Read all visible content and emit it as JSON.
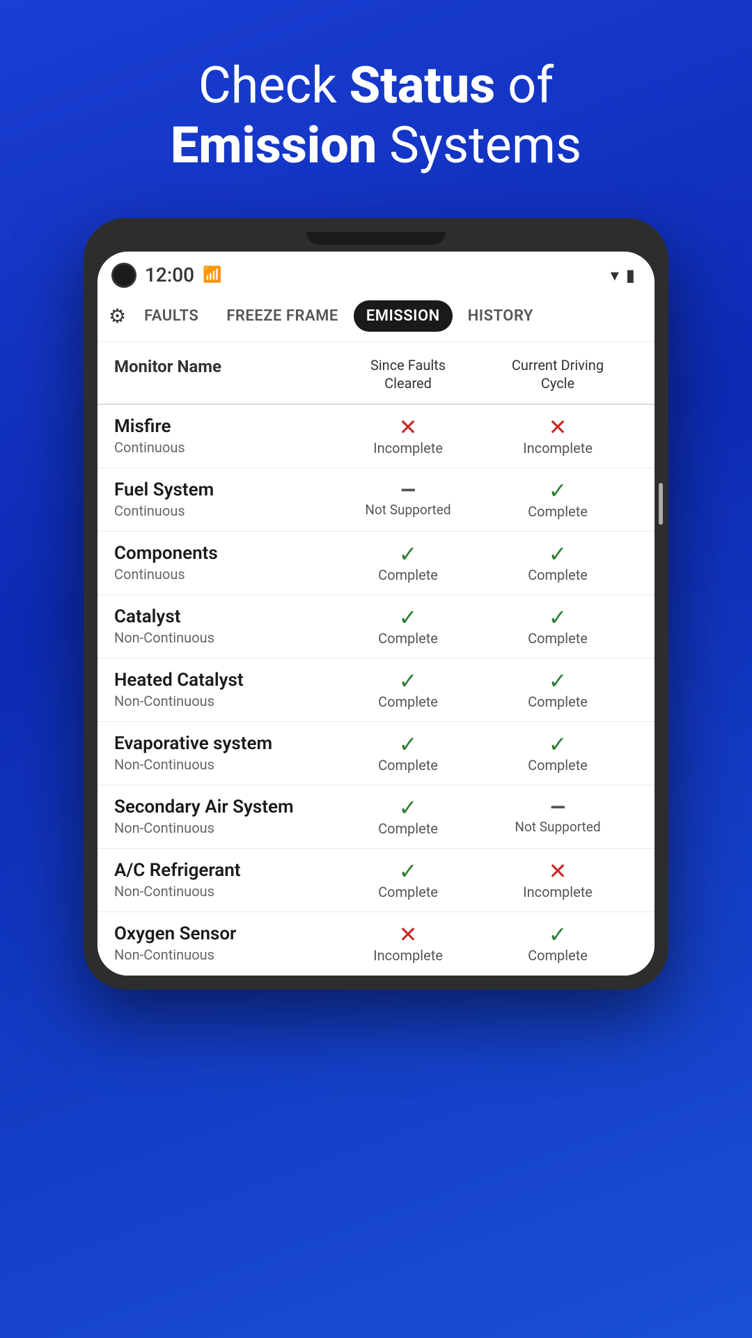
{
  "hero": {
    "line1": "Check ",
    "line1_bold": "Status",
    "line1_end": " of",
    "line2_bold": "Emission",
    "line2_end": " Systems"
  },
  "status_bar": {
    "time": "12:00"
  },
  "nav": {
    "tabs": [
      {
        "id": "faults",
        "label": "Faults",
        "active": false
      },
      {
        "id": "freeze_frame",
        "label": "Freeze Frame",
        "active": false
      },
      {
        "id": "emission",
        "label": "Emission",
        "active": true
      },
      {
        "id": "history",
        "label": "History",
        "active": false
      }
    ]
  },
  "table": {
    "headers": [
      "Monitor Name",
      "Since Faults\nCleared",
      "Current Driving\nCycle"
    ],
    "rows": [
      {
        "name": "Misfire",
        "type": "Continuous",
        "since_faults": {
          "type": "incomplete",
          "text": "Incomplete"
        },
        "current_cycle": {
          "type": "incomplete",
          "text": "Incomplete"
        }
      },
      {
        "name": "Fuel System",
        "type": "Continuous",
        "since_faults": {
          "type": "not_supported",
          "text": "Not Supported"
        },
        "current_cycle": {
          "type": "complete",
          "text": "Complete"
        }
      },
      {
        "name": "Components",
        "type": "Continuous",
        "since_faults": {
          "type": "complete",
          "text": "Complete"
        },
        "current_cycle": {
          "type": "complete",
          "text": "Complete"
        }
      },
      {
        "name": "Catalyst",
        "type": "Non-Continuous",
        "since_faults": {
          "type": "complete",
          "text": "Complete"
        },
        "current_cycle": {
          "type": "complete",
          "text": "Complete"
        }
      },
      {
        "name": "Heated Catalyst",
        "type": "Non-Continuous",
        "since_faults": {
          "type": "complete",
          "text": "Complete"
        },
        "current_cycle": {
          "type": "complete",
          "text": "Complete"
        }
      },
      {
        "name": "Evaporative system",
        "type": "Non-Continuous",
        "since_faults": {
          "type": "complete",
          "text": "Complete"
        },
        "current_cycle": {
          "type": "complete",
          "text": "Complete"
        }
      },
      {
        "name": "Secondary Air System",
        "type": "Non-Continuous",
        "since_faults": {
          "type": "complete",
          "text": "Complete"
        },
        "current_cycle": {
          "type": "not_supported",
          "text": "Not Supported"
        }
      },
      {
        "name": "A/C Refrigerant",
        "type": "Non-Continuous",
        "since_faults": {
          "type": "complete",
          "text": "Complete"
        },
        "current_cycle": {
          "type": "incomplete",
          "text": "Incomplete"
        }
      },
      {
        "name": "Oxygen Sensor",
        "type": "Non-Continuous",
        "since_faults": {
          "type": "incomplete",
          "text": "Incomplete"
        },
        "current_cycle": {
          "type": "complete",
          "text": "Complete"
        }
      }
    ]
  }
}
